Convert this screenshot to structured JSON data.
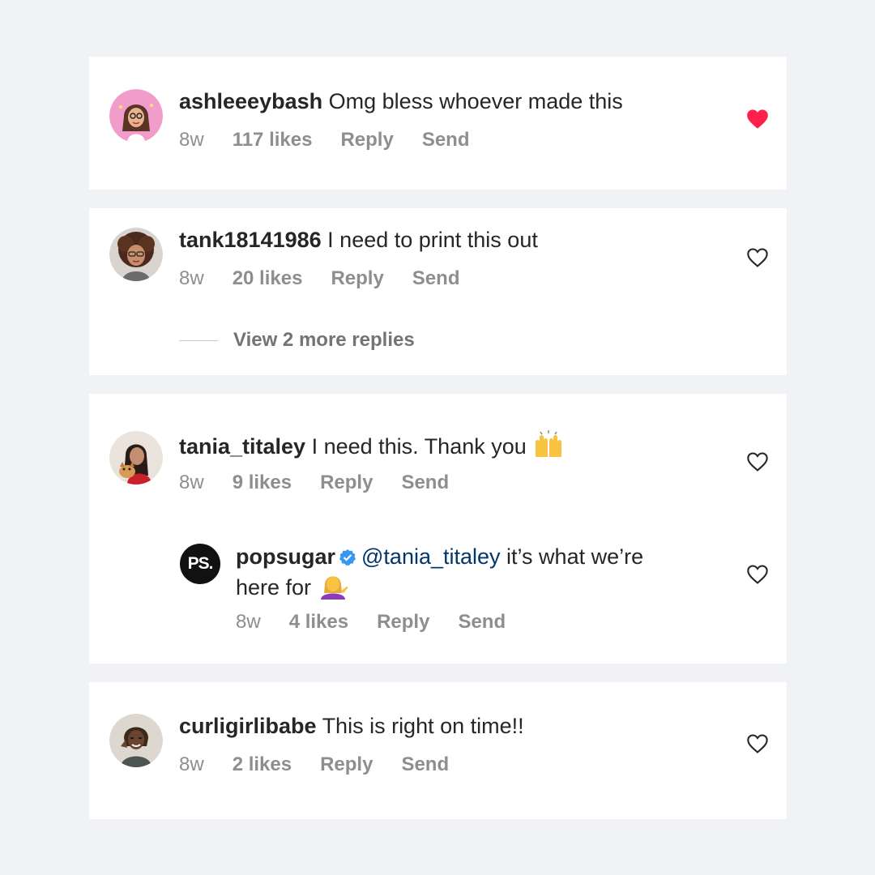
{
  "comments": [
    {
      "username": "ashleeeybash",
      "text": "Omg bless whoever made this",
      "time": "8w",
      "likes": "117 likes",
      "reply": "Reply",
      "send": "Send",
      "liked": true
    },
    {
      "username": "tank18141986",
      "text": "I need to print this out",
      "time": "8w",
      "likes": "20 likes",
      "reply": "Reply",
      "send": "Send",
      "liked": false,
      "more_replies": "View 2 more replies"
    },
    {
      "username": "tania_titaley",
      "text": "I need this. Thank you",
      "time": "8w",
      "likes": "9 likes",
      "reply": "Reply",
      "send": "Send",
      "liked": false,
      "emoji": "raising-hands-emoji",
      "reply_item": {
        "username": "popsugar",
        "mention": "@tania_titaley",
        "text": "it’s what we’re",
        "text_line2": "here for",
        "emoji": "person-tipping-hand-emoji",
        "avatar_text": "PS.",
        "time": "8w",
        "likes": "4 likes",
        "reply": "Reply",
        "send": "Send",
        "liked": false
      }
    },
    {
      "username": "curligirlibabe",
      "text": "This is right on time!!",
      "time": "8w",
      "likes": "2 likes",
      "reply": "Reply",
      "send": "Send",
      "liked": false
    }
  ],
  "colors": {
    "background": "#f1f2f6",
    "liked_heart": "#ff1f4b",
    "mention": "#00376b",
    "verified": "#3897f0",
    "meta_text": "#8e8e8e"
  }
}
